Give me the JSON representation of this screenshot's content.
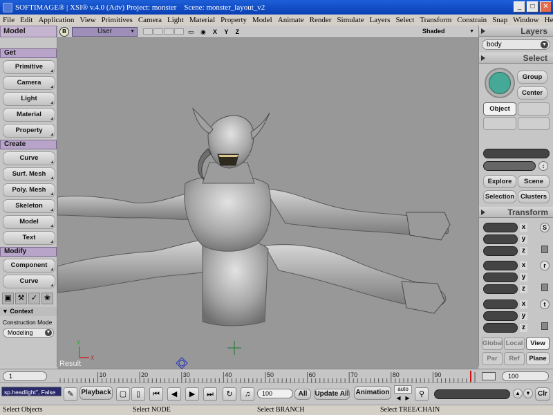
{
  "window": {
    "title": "SOFTIMAGE® | XSI® v.4.0 (Adv) Project: monster    Scene: monster_layout_v2",
    "buttons": [
      "_",
      "□",
      "✕"
    ]
  },
  "menu": [
    "File",
    "Edit",
    "Application",
    "View",
    "Primitives",
    "Camera",
    "Light",
    "Material",
    "Property",
    "Model",
    "Animate",
    "Render",
    "Simulate",
    "Layers",
    "Select",
    "Transform",
    "Constrain",
    "Snap",
    "Window",
    "Help"
  ],
  "left_panel": {
    "mode": "Model",
    "sections": [
      {
        "header": "Get",
        "buttons": [
          "Primitive",
          "Camera",
          "Light",
          "Material",
          "Property"
        ]
      },
      {
        "header": "Create",
        "buttons": [
          "Curve",
          "Surf. Mesh",
          "Poly. Mesh",
          "Skeleton",
          "Model",
          "Text"
        ]
      },
      {
        "header": "Modify",
        "buttons": [
          "Component",
          "Curve"
        ]
      }
    ],
    "context": {
      "header": "Context",
      "label": "Construction Mode",
      "value": "Modeling"
    }
  },
  "viewport": {
    "letter": "B",
    "camera": "User",
    "axes": "X Y Z",
    "display_mode": "Shaded",
    "label": "Result",
    "axis_x": "X",
    "axis_y": "Y"
  },
  "right_panel": {
    "layers_header": "Layers",
    "layer": "body",
    "select_header": "Select",
    "group_btn": "Group",
    "center_btn": "Center",
    "object_btn": "Object",
    "explore_btn": "Explore",
    "scene_btn": "Scene",
    "selection_btn": "Selection",
    "clusters_btn": "Clusters",
    "transform_header": "Transform",
    "axis_x": "x",
    "axis_y": "y",
    "axis_z": "z",
    "icon_s": "S",
    "icon_r": "r",
    "icon_t": "t",
    "global_btn": "Global",
    "local_btn": "Local",
    "view_btn": "View",
    "par_btn": "Par",
    "ref_btn": "Ref",
    "plane_btn": "Plane"
  },
  "timeline": {
    "start": "1",
    "end": "100",
    "ticks": [
      "10",
      "20",
      "30",
      "40",
      "50",
      "60",
      "70",
      "80",
      "90"
    ],
    "current_frame_fraction": 0.99
  },
  "playback": {
    "command": "sp.headlight\", False",
    "playback_btn": "Playback",
    "frame": "100",
    "all_btn": "All",
    "update_btn": "Update All",
    "animation_btn": "Animation",
    "auto_label": "auto",
    "clr_btn": "Clr"
  },
  "status": {
    "left": "Select Objects",
    "node": "Select NODE",
    "branch": "Select BRANCH",
    "tree": "Select TREE/CHAIN"
  }
}
